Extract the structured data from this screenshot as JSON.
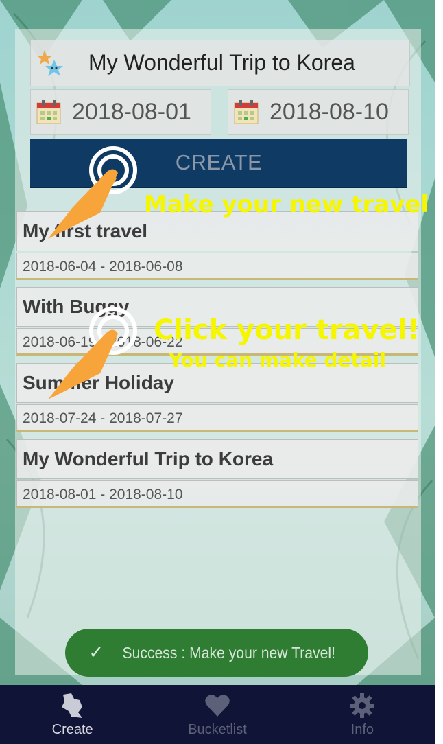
{
  "form": {
    "title_value": "My Wonderful Trip to Korea",
    "start_date": "2018-08-01",
    "end_date": "2018-08-10",
    "create_label": "CREATE"
  },
  "hints": {
    "make_new": "Make your new travel",
    "click_travel": "Click your travel!",
    "make_detail": "You can make detail"
  },
  "travels": [
    {
      "name": "My first travel",
      "dates": "2018-06-04 - 2018-06-08"
    },
    {
      "name": "With Buggy",
      "dates": "2018-06-19 - 2018-06-22"
    },
    {
      "name": "Summer Holiday",
      "dates": "2018-07-24 - 2018-07-27"
    },
    {
      "name": "My Wonderful Trip to Korea",
      "dates": "2018-08-01 - 2018-08-10"
    }
  ],
  "toast": {
    "message": "Success : Make your new Travel!"
  },
  "nav": [
    {
      "label": "Create",
      "icon": "map-pieces-icon",
      "active": true
    },
    {
      "label": "Bucketlist",
      "icon": "heart-icon",
      "active": false
    },
    {
      "label": "Info",
      "icon": "gear-icon",
      "active": false
    }
  ],
  "colors": {
    "create_button": "#0e3a63",
    "hint_text": "#f6f600",
    "toast": "#2e7d32",
    "nav_bar": "#101436",
    "hand": "#f7a53a"
  }
}
